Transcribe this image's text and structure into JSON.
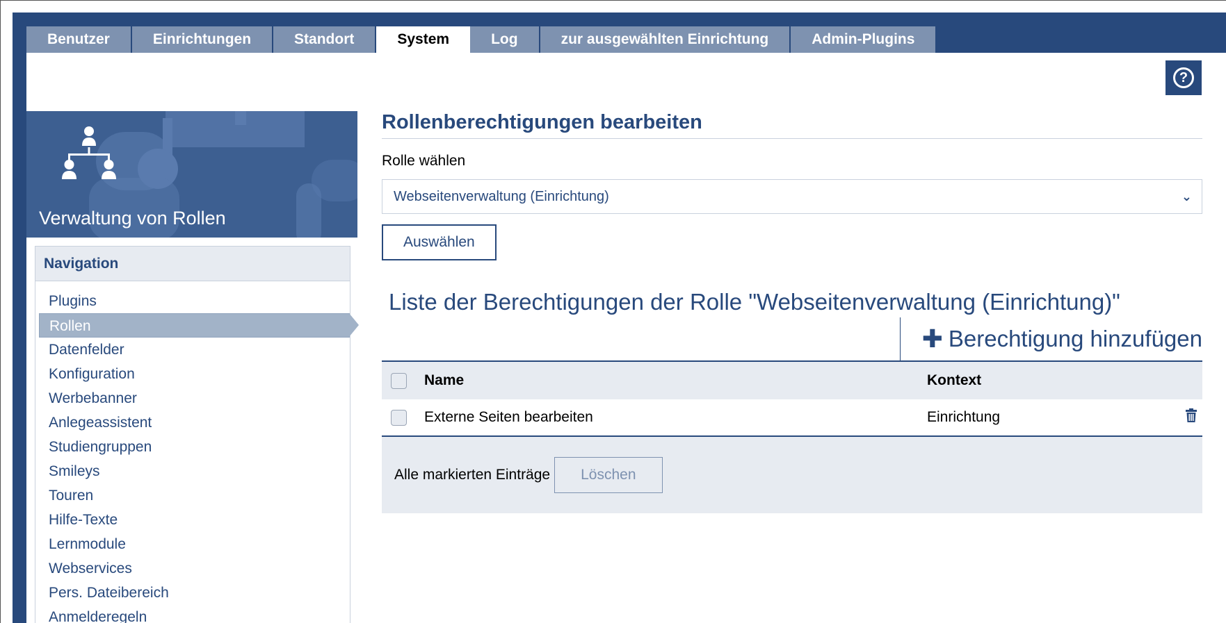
{
  "tabs": [
    {
      "label": "Benutzer"
    },
    {
      "label": "Einrichtungen"
    },
    {
      "label": "Standort"
    },
    {
      "label": "System",
      "active": true
    },
    {
      "label": "Log"
    },
    {
      "label": "zur ausgewählten Einrichtung"
    },
    {
      "label": "Admin-Plugins"
    }
  ],
  "help": {
    "icon": "help-circle-icon",
    "glyph": "?"
  },
  "sidebar": {
    "title": "Verwaltung von Rollen",
    "icon": "org-chart-icon",
    "nav_header": "Navigation",
    "items": [
      {
        "label": "Plugins"
      },
      {
        "label": "Rollen",
        "active": true
      },
      {
        "label": "Datenfelder"
      },
      {
        "label": "Konfiguration"
      },
      {
        "label": "Werbebanner"
      },
      {
        "label": "Anlegeassistent"
      },
      {
        "label": "Studiengruppen"
      },
      {
        "label": "Smileys"
      },
      {
        "label": "Touren"
      },
      {
        "label": "Hilfe-Texte"
      },
      {
        "label": "Lernmodule"
      },
      {
        "label": "Webservices"
      },
      {
        "label": "Pers. Dateibereich"
      },
      {
        "label": "Anmelderegeln"
      }
    ]
  },
  "main": {
    "heading": "Rollenberechtigungen bearbeiten",
    "role_label": "Rolle wählen",
    "role_selected": "Webseitenverwaltung (Einrichtung)",
    "select_button": "Auswählen",
    "list_caption": "Liste der Berechtigungen der Rolle \"Webseitenverwaltung (Einrichtung)\"",
    "add_action": "Berechtigung hinzufügen",
    "table": {
      "col_name": "Name",
      "col_context": "Kontext",
      "rows": [
        {
          "name": "Externe Seiten bearbeiten",
          "context": "Einrichtung"
        }
      ],
      "footer_label": "Alle markierten Einträge",
      "delete_button": "Löschen"
    }
  },
  "colors": {
    "primary": "#28497c",
    "tab_inactive": "#7e92b0",
    "light_bg": "#e7ebf1"
  }
}
